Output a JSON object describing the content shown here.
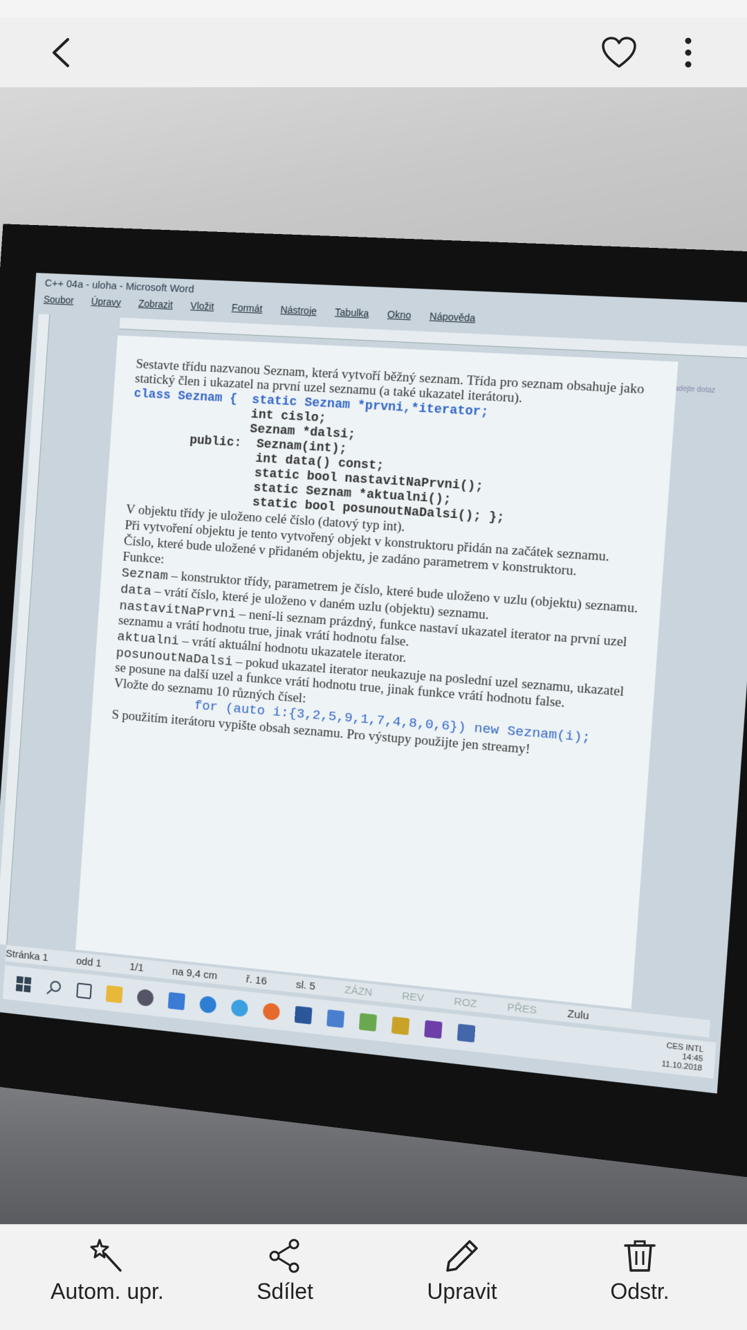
{
  "topbar": {
    "back_icon": "chevron-left-icon",
    "favorite_icon": "heart-icon",
    "more_icon": "more-vertical-icon"
  },
  "photo": {
    "word": {
      "title": "C++ 04a - uloha - Microsoft Word",
      "help_chip": "Nápověda – zadejte dotaz",
      "menu": [
        "Soubor",
        "Úpravy",
        "Zobrazit",
        "Vložit",
        "Formát",
        "Nástroje",
        "Tabulka",
        "Okno",
        "Nápověda"
      ],
      "doc": {
        "intro": "Sestavte třídu nazvanou Seznam, která vytvoří běžný seznam. Třída pro seznam obsahuje jako statický člen i ukazatel na první uzel seznamu (a také ukazatel iterátoru).",
        "code_lines": [
          "class Seznam {  static Seznam *prvni,*iterator;",
          "                int cislo;",
          "                Seznam *dalsi;",
          "        public:  Seznam(int);",
          "                 int data() const;",
          "                 static bool nastavitNaPrvni();",
          "                 static Seznam *aktualni();",
          "                 static bool posunoutNaDalsi(); };"
        ],
        "p1": "V objektu třídy je uloženo celé číslo (datový typ int).",
        "p2": "Při vytvoření objektu je tento vytvořený objekt v konstruktoru přidán na začátek seznamu.",
        "p3": "Číslo, které bude uložené v přidaném objektu, je zadáno parametrem v konstruktoru.",
        "p4": "Funkce:",
        "f1_name": "Seznam",
        "f1_text": " – konstruktor třídy, parametrem je číslo, které bude uloženo v uzlu (objektu) seznamu.",
        "f2_name": "data",
        "f2_text": " – vrátí číslo, které je uloženo v daném uzlu (objektu) seznamu.",
        "f3_name": "nastavitNaPrvni",
        "f3_text": " – není-li seznam prázdný, funkce nastaví ukazatel iterator na první uzel seznamu a vrátí hodnotu true, jinak vrátí hodnotu false.",
        "f4_name": "aktualni",
        "f4_text": " – vrátí aktuální hodnotu ukazatele iterator.",
        "f5_name": "posunoutNaDalsi",
        "f5_text": " – pokud ukazatel iterator neukazuje na poslední uzel seznamu, ukazatel se posune na další uzel a funkce vrátí hodnotu true, jinak funkce vrátí hodnotu false.",
        "p5": "Vložte do seznamu 10 různých čísel:",
        "for_line": "for (auto i:{3,2,5,9,1,7,4,8,0,6}) new Seznam(i);",
        "p6": "S použitím iterátoru vypište obsah seznamu. Pro výstupy použijte jen streamy!"
      },
      "status": [
        "Stránka 1",
        "odd 1",
        "1/1",
        "na 9,4 cm",
        "ř. 16",
        "sl. 5",
        "ZÁZN",
        "REV",
        "ROZ",
        "PŘES",
        "Zulu"
      ],
      "tray_lang": "CES INTL",
      "tray_time": "14:45",
      "tray_date": "11.10.2018"
    }
  },
  "actions": [
    {
      "label": "Autom. upr.",
      "icon": "magic-wand-icon"
    },
    {
      "label": "Sdílet",
      "icon": "share-icon"
    },
    {
      "label": "Upravit",
      "icon": "pencil-icon"
    },
    {
      "label": "Odstr.",
      "icon": "trash-icon"
    }
  ]
}
